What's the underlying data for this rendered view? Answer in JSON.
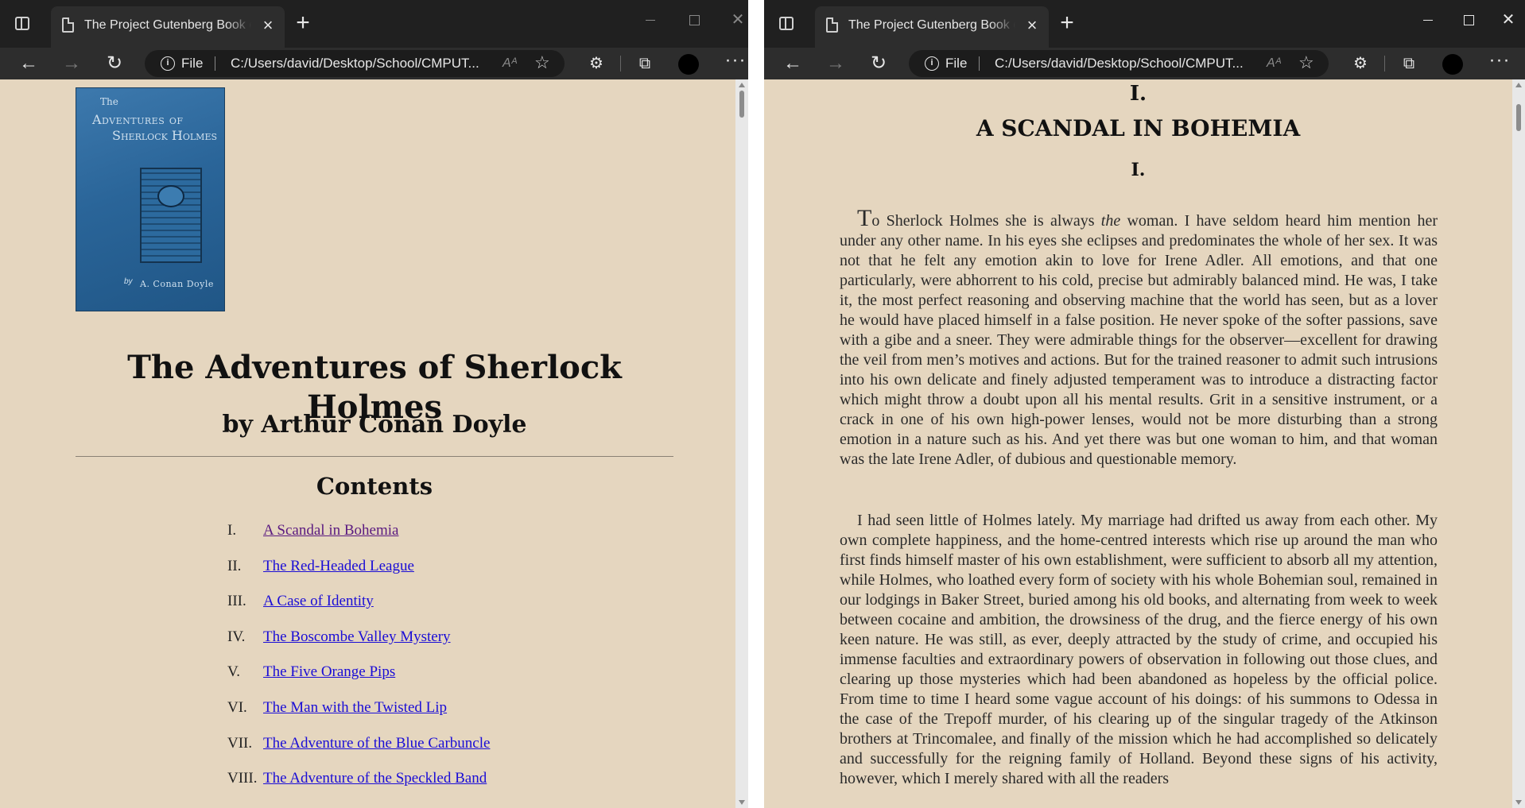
{
  "windows": {
    "left": {
      "tab_title": "The Project Gutenberg Book of The Adventures of Sherlock Holmes",
      "address": {
        "scheme_label": "File",
        "url": "C:/Users/david/Desktop/School/CMPUT...",
        "read_aloud": "Aᴬ"
      },
      "cover": {
        "title_line1": "The",
        "title_line2": "Adventures of",
        "title_line3": "Sherlock Holmes",
        "by": "by",
        "author": "A. Conan Doyle"
      },
      "book_title": "The Adventures of Sherlock Holmes",
      "book_author": "by Arthur Conan Doyle",
      "contents_heading": "Contents",
      "toc": [
        {
          "num": "I.",
          "label": "A Scandal in Bohemia",
          "visited": true
        },
        {
          "num": "II.",
          "label": "The Red-Headed League",
          "visited": false
        },
        {
          "num": "III.",
          "label": "A Case of Identity",
          "visited": false
        },
        {
          "num": "IV.",
          "label": "The Boscombe Valley Mystery",
          "visited": false
        },
        {
          "num": "V.",
          "label": "The Five Orange Pips",
          "visited": false
        },
        {
          "num": "VI.",
          "label": "The Man with the Twisted Lip",
          "visited": false
        },
        {
          "num": "VII.",
          "label": "The Adventure of the Blue Carbuncle",
          "visited": false
        },
        {
          "num": "VIII.",
          "label": "The Adventure of the Speckled Band",
          "visited": false
        }
      ],
      "scroll_fraction": 0.0
    },
    "right": {
      "tab_title": "The Project Gutenberg Book of The Adventures of Sherlock Holmes",
      "address": {
        "scheme_label": "File",
        "url": "C:/Users/david/Desktop/School/CMPUT...",
        "read_aloud": "Aᴬ"
      },
      "chapter_number": "I.",
      "chapter_title": "A SCANDAL IN BOHEMIA",
      "section_number": "I.",
      "para1_dropcap": "T",
      "para1_pre": "o Sherlock Holmes she is always ",
      "para1_em": "the",
      "para1_post": " woman. I have seldom heard him mention her under any other name. In his eyes she eclipses and predominates the whole of her sex. It was not that he felt any emotion akin to love for Irene Adler. All emotions, and that one particularly, were abhorrent to his cold, precise but admirably balanced mind. He was, I take it, the most perfect reasoning and observing machine that the world has seen, but as a lover he would have placed himself in a false position. He never spoke of the softer passions, save with a gibe and a sneer. They were admirable things for the observer—excellent for drawing the veil from men’s motives and actions. But for the trained reasoner to admit such intrusions into his own delicate and finely adjusted temperament was to introduce a distracting factor which might throw a doubt upon all his mental results. Grit in a sensitive instrument, or a crack in one of his own high-power lenses, would not be more disturbing than a strong emotion in a nature such as his. And yet there was but one woman to him, and that woman was the late Irene Adler, of dubious and questionable memory.",
      "para2": "I had seen little of Holmes lately. My marriage had drifted us away from each other. My own complete happiness, and the home-centred interests which rise up around the man who first finds himself master of his own establishment, were sufficient to absorb all my attention, while Holmes, who loathed every form of society with his whole Bohemian soul, remained in our lodgings in Baker Street, buried among his old books, and alternating from week to week between cocaine and ambition, the drowsiness of the drug, and the fierce energy of his own keen nature. He was still, as ever, deeply attracted by the study of crime, and occupied his immense faculties and extraordinary powers of observation in following out those clues, and clearing up those mysteries which had been abandoned as hopeless by the official police. From time to time I heard some vague account of his doings: of his summons to Odessa in the case of the Trepoff murder, of his clearing up of the singular tragedy of the Atkinson brothers at Trincomalee, and finally of the mission which he had accomplished so delicately and successfully for the reigning family of Holland. Beyond these signs of his activity, however, which I merely shared with all the readers",
      "scroll_fraction": 0.02
    }
  },
  "colors": {
    "page_background": "#e5d6bf",
    "link": "#1a0dd6",
    "visited_link": "#5a1a80",
    "chrome_dark": "#202020"
  }
}
